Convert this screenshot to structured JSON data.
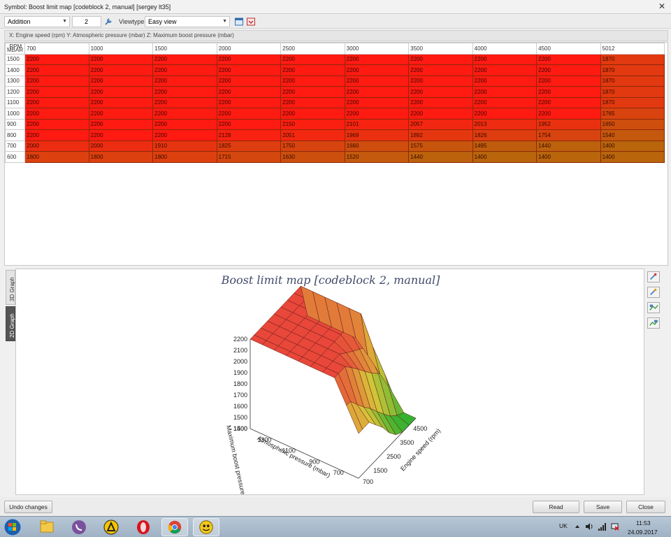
{
  "window": {
    "title": "Symbol: Boost limit map [codeblock 2, manual] [sergey lt35]",
    "close_glyph": "✕"
  },
  "toolbar": {
    "operation": "Addition",
    "operand": "2",
    "viewtype_label": "Viewtype",
    "viewtype": "Easy view",
    "icons": [
      "wrench-icon",
      "window-icon",
      "sync-icon"
    ]
  },
  "axis_info": "X: Engine speed (rpm) Y: Atmospheric pressure (mbar) Z: Maximum boost pressure (mbar)",
  "grid": {
    "corner_top": "RPM",
    "corner_bottom": "MBAR",
    "columns": [
      "700",
      "1000",
      "1500",
      "2000",
      "2500",
      "3000",
      "3500",
      "4000",
      "4500",
      "5012"
    ],
    "rows": [
      {
        "label": "1500",
        "values": [
          "2200",
          "2200",
          "2200",
          "2200",
          "2200",
          "2200",
          "2200",
          "2200",
          "2200",
          "1870"
        ]
      },
      {
        "label": "1400",
        "values": [
          "2200",
          "2200",
          "2200",
          "2200",
          "2200",
          "2200",
          "2200",
          "2200",
          "2200",
          "1870"
        ]
      },
      {
        "label": "1300",
        "values": [
          "2200",
          "2200",
          "2200",
          "2200",
          "2200",
          "2200",
          "2200",
          "2200",
          "2200",
          "1870"
        ]
      },
      {
        "label": "1200",
        "values": [
          "2200",
          "2200",
          "2200",
          "2200",
          "2200",
          "2200",
          "2200",
          "2200",
          "2200",
          "1870"
        ]
      },
      {
        "label": "1100",
        "values": [
          "2200",
          "2200",
          "2200",
          "2200",
          "2200",
          "2200",
          "2200",
          "2200",
          "2200",
          "1870"
        ]
      },
      {
        "label": "1000",
        "values": [
          "2200",
          "2200",
          "2200",
          "2200",
          "2200",
          "2200",
          "2200",
          "2200",
          "2200",
          "1765"
        ]
      },
      {
        "label": "900",
        "values": [
          "2200",
          "2200",
          "2200",
          "2200",
          "2150",
          "2101",
          "2057",
          "2013",
          "1952",
          "1650"
        ]
      },
      {
        "label": "800",
        "values": [
          "2200",
          "2200",
          "2200",
          "2128",
          "2051",
          "1969",
          "1892",
          "1826",
          "1754",
          "1540"
        ]
      },
      {
        "label": "700",
        "values": [
          "2000",
          "2000",
          "1910",
          "1825",
          "1750",
          "1660",
          "1575",
          "1495",
          "1440",
          "1400"
        ]
      },
      {
        "label": "600",
        "values": [
          "1800",
          "1800",
          "1800",
          "1715",
          "1630",
          "1520",
          "1440",
          "1400",
          "1400",
          "1400"
        ]
      }
    ]
  },
  "graph": {
    "tabs": [
      "3D Graph",
      "2D Graph"
    ],
    "active_tab": "2D Graph",
    "title": "Boost limit map [codeblock 2, manual]",
    "z_label": "Maximum boost pressure (mbar)",
    "y_label": "Atmospheric pressure (mbar)",
    "x_label": "Engine speed (rpm)",
    "z_ticks": [
      "2200",
      "2100",
      "2000",
      "1900",
      "1800",
      "1700",
      "1600",
      "1500",
      "1400"
    ],
    "y_ticks": [
      "1500",
      "1300",
      "1100",
      "900",
      "700"
    ],
    "x_ticks": [
      "4500",
      "3500",
      "2500",
      "1500",
      "700"
    ],
    "side_buttons": [
      "zoom-in-icon",
      "zoom-out-icon",
      "rotate-icon",
      "reset-view-icon"
    ]
  },
  "buttons": {
    "undo": "Undo changes",
    "read": "Read",
    "save": "Save",
    "close": "Close"
  },
  "taskbar": {
    "apps": [
      "explorer-icon",
      "viber-icon",
      "archicad-icon",
      "opera-icon",
      "chrome-icon",
      "editor-icon"
    ],
    "language": "UK",
    "time": "11:53",
    "date": "24.09.2017"
  },
  "colors": {
    "cell_high": "#ff1a12",
    "cell_low": "#b8650c",
    "surface_high": "#e8473a",
    "surface_low": "#2fb02f"
  }
}
